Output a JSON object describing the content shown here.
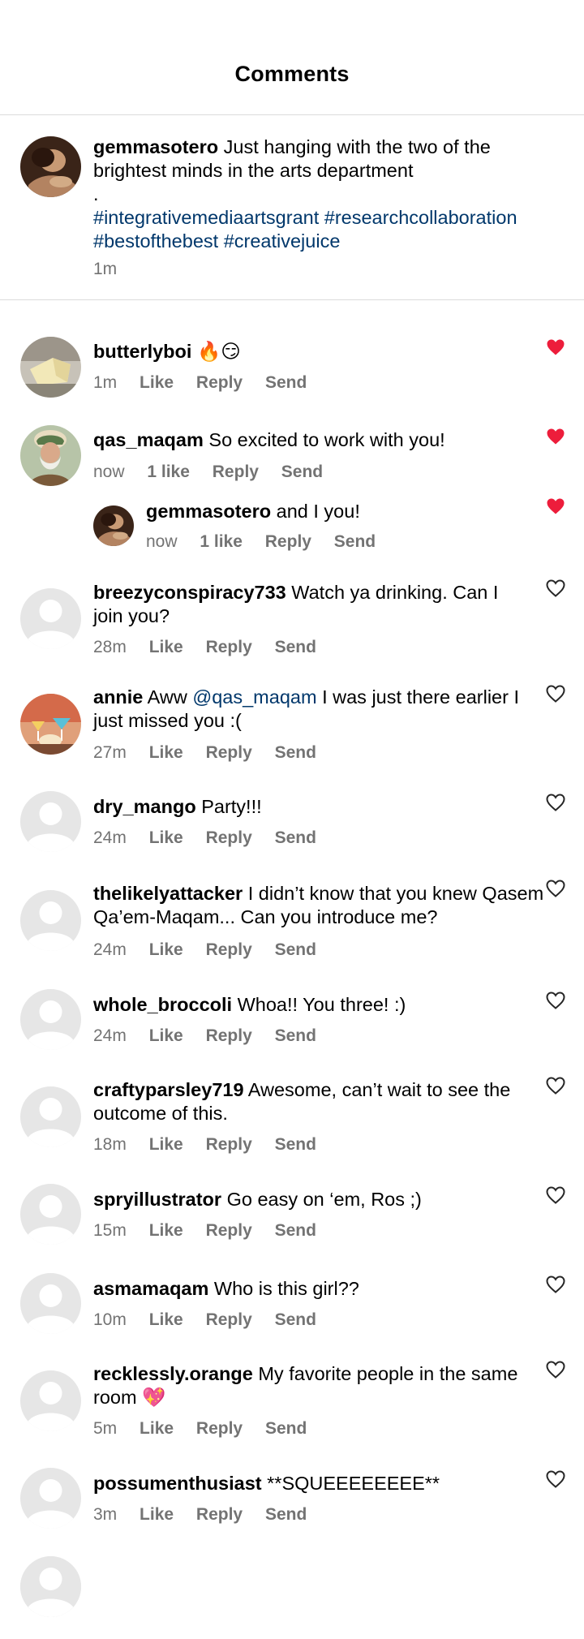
{
  "header": {
    "title": "Comments"
  },
  "caption": {
    "username": "gemmasotero",
    "text_line1": "Just hanging with the two of the",
    "text_line2": "brightest minds in the arts department",
    "dot": ".",
    "tags_line1": "#integrativemediaartsgrant #researchcollaboration",
    "tags_line2": "#bestofthebest #creativejuice",
    "time": "1m"
  },
  "labels": {
    "like": "Like",
    "reply": "Reply",
    "send": "Send"
  },
  "colors": {
    "liked_heart": "#ed1d3b",
    "meta_gray": "#737373",
    "link_blue": "#00376b"
  },
  "comments": [
    {
      "username": "butterlyboi",
      "text": "🔥😏",
      "time": "1m",
      "likes": "Like",
      "liked": true,
      "avatar": "butter"
    },
    {
      "username": "qas_maqam",
      "text": "So excited to work with you!",
      "time": "now",
      "likes": "1 like",
      "liked": true,
      "avatar": "sage"
    },
    {
      "username": "gemmasotero",
      "text": "and I you!",
      "time": "now",
      "likes": "1 like",
      "liked": true,
      "avatar": "painting",
      "reply": true
    },
    {
      "username": "breezyconspiracy733",
      "text": "Watch ya drinking. Can I join you?",
      "time": "28m",
      "likes": "Like",
      "liked": false,
      "avatar": "default"
    },
    {
      "username": "annie",
      "text_pre": "Aww",
      "mention": "@qas_maqam",
      "text": "I was just there earlier I just missed you :(",
      "time": "27m",
      "likes": "Like",
      "liked": false,
      "avatar": "cocktail"
    },
    {
      "username": "dry_mango",
      "text": "Party!!!",
      "time": "24m",
      "likes": "Like",
      "liked": false,
      "avatar": "default"
    },
    {
      "username": "thelikelyattacker",
      "text": "I didn’t know that you knew Qasem Qa’em-Maqam... Can you introduce me?",
      "time": "24m",
      "likes": "Like",
      "liked": false,
      "avatar": "default"
    },
    {
      "username": "whole_broccoli",
      "text": "Whoa!! You three! :)",
      "time": "24m",
      "likes": "Like",
      "liked": false,
      "avatar": "default"
    },
    {
      "username": "craftyparsley719",
      "text": "Awesome, can’t wait to see the outcome of this.",
      "time": "18m",
      "likes": "Like",
      "liked": false,
      "avatar": "default"
    },
    {
      "username": "spryillustrator",
      "text": "Go easy on ‘em, Ros ;)",
      "time": "15m",
      "likes": "Like",
      "liked": false,
      "avatar": "default"
    },
    {
      "username": "asmamaqam",
      "text": "Who is this girl??",
      "time": "10m",
      "likes": "Like",
      "liked": false,
      "avatar": "default"
    },
    {
      "username": "recklessly.orange",
      "text": "My favorite people in the same room 💖",
      "time": "5m",
      "likes": "Like",
      "liked": false,
      "avatar": "default"
    },
    {
      "username": "possumenthusiast",
      "text": "**SQUEEEEEEEE**",
      "time": "3m",
      "likes": "Like",
      "liked": false,
      "avatar": "default"
    }
  ]
}
